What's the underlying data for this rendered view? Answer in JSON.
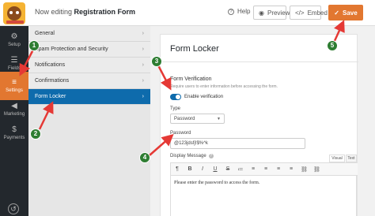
{
  "header": {
    "title_prefix": "Now editing",
    "form_name": "Registration Form",
    "help_label": "Help",
    "preview_label": "Preview",
    "embed_label": "Embed",
    "save_label": "Save"
  },
  "leftnav": {
    "items": [
      {
        "label": "Setup",
        "icon": "gear-icon"
      },
      {
        "label": "Fields",
        "icon": "list-icon"
      },
      {
        "label": "Settings",
        "icon": "sliders-icon",
        "active": true
      },
      {
        "label": "Marketing",
        "icon": "megaphone-icon"
      },
      {
        "label": "Payments",
        "icon": "dollar-icon"
      }
    ]
  },
  "settings": {
    "items": [
      {
        "label": "General"
      },
      {
        "label": "Spam Protection and Security"
      },
      {
        "label": "Notifications"
      },
      {
        "label": "Confirmations"
      },
      {
        "label": "Form Locker",
        "active": true
      }
    ]
  },
  "form_locker": {
    "title": "Form Locker",
    "verification_title": "Form Verification",
    "verification_desc": "Require users to enter information before accessing the form.",
    "enable_label": "Enable verification",
    "enabled": true,
    "type_label": "Type",
    "type_value": "Password",
    "password_label": "Password",
    "password_value": "@123jdsfj!$%^k",
    "display_message_label": "Display Message",
    "tab_visual": "Visual",
    "tab_text": "Text",
    "message": "Please enter the password to access the form."
  },
  "annotations": [
    "1",
    "2",
    "3",
    "4",
    "5"
  ],
  "colors": {
    "accent_orange": "#e27730",
    "active_blue": "#0e6bac",
    "annotation_green": "#2e7d32",
    "arrow_red": "#e53935"
  }
}
